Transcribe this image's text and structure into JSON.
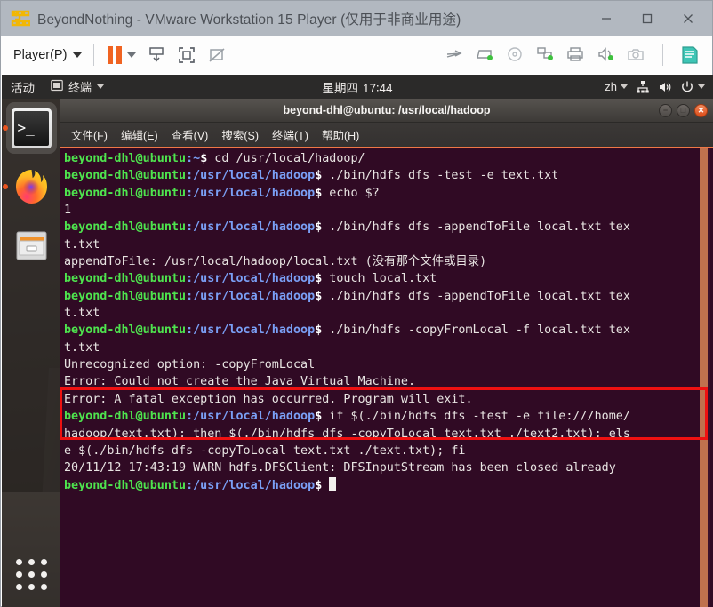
{
  "vmware": {
    "title": "BeyondNothing - VMware Workstation 15 Player (仅用于非商业用途)",
    "logo_icon": "vmware-logo-icon",
    "window_controls": [
      {
        "name": "minimize",
        "glyph": "—"
      },
      {
        "name": "maximize",
        "glyph": "▢"
      },
      {
        "name": "close",
        "glyph": "✕"
      }
    ],
    "toolbar": {
      "player_menu_label": "Player(P)",
      "left_icons": [
        "pause-icon",
        "pause-dropdown-caret-icon",
        "send-ctrl-alt-del-icon",
        "fullscreen-icon",
        "unity-mode-icon"
      ],
      "right_icons": [
        "network-adapter-icon",
        "removable-device-icon",
        "cd-dvd-icon",
        "network-icon",
        "printer-icon",
        "sound-icon",
        "camera-icon",
        "sidebar-icon"
      ]
    }
  },
  "ubuntu": {
    "topbar": {
      "activities_label": "活动",
      "app_menu_icon": "terminal-window-icon",
      "app_menu_label": "终端",
      "clock_day": "星期四",
      "clock_time": "17∶44",
      "tray": {
        "input_method_label": "zh",
        "network_icon": "network-wired-icon",
        "volume_icon": "volume-icon",
        "power_icon": "power-icon"
      }
    },
    "dock": {
      "items": [
        {
          "name": "terminal",
          "icon": "terminal-icon",
          "running": true,
          "focused": true,
          "glyph": ">_"
        },
        {
          "name": "firefox",
          "icon": "firefox-icon",
          "running": true,
          "focused": false
        },
        {
          "name": "files",
          "icon": "files-icon",
          "running": false,
          "focused": false
        }
      ],
      "show_apps_label": "show-applications"
    }
  },
  "terminal": {
    "title": "beyond-dhl@ubuntu: /usr/local/hadoop",
    "window_buttons": [
      {
        "name": "minimize",
        "glyph": "−"
      },
      {
        "name": "maximize",
        "glyph": "□"
      },
      {
        "name": "close",
        "glyph": "✕"
      }
    ],
    "menus": [
      "文件(F)",
      "编辑(E)",
      "查看(V)",
      "搜索(S)",
      "终端(T)",
      "帮助(H)"
    ],
    "prompt_user": "beyond-dhl@ubuntu",
    "colors": {
      "background": "#300a24",
      "user": "#4ee44e",
      "path": "#7a9ff5",
      "text": "#e8e4e2",
      "scrollbar": "#c0714e",
      "annotation": "#ee1111"
    },
    "lines": [
      {
        "type": "prompt",
        "cwd": ":~",
        "cmd": " cd /usr/local/hadoop/"
      },
      {
        "type": "prompt",
        "cwd": ":/usr/local/hadoop",
        "cmd": " ./bin/hdfs dfs -test -e text.txt"
      },
      {
        "type": "prompt",
        "cwd": ":/usr/local/hadoop",
        "cmd": " echo $?"
      },
      {
        "type": "out",
        "text": "1"
      },
      {
        "type": "prompt",
        "cwd": ":/usr/local/hadoop",
        "cmd": " ./bin/hdfs dfs -appendToFile local.txt tex"
      },
      {
        "type": "out",
        "text": "t.txt"
      },
      {
        "type": "out",
        "text": "appendToFile: /usr/local/hadoop/local.txt (没有那个文件或目录)"
      },
      {
        "type": "prompt",
        "cwd": ":/usr/local/hadoop",
        "cmd": " touch local.txt"
      },
      {
        "type": "prompt",
        "cwd": ":/usr/local/hadoop",
        "cmd": " ./bin/hdfs dfs -appendToFile local.txt tex"
      },
      {
        "type": "out",
        "text": "t.txt"
      },
      {
        "type": "prompt",
        "cwd": ":/usr/local/hadoop",
        "cmd": " ./bin/hdfs -copyFromLocal -f local.txt tex"
      },
      {
        "type": "out",
        "text": "t.txt"
      },
      {
        "type": "out",
        "text": "Unrecognized option: -copyFromLocal"
      },
      {
        "type": "out",
        "text": "Error: Could not create the Java Virtual Machine."
      },
      {
        "type": "out",
        "text": "Error: A fatal exception has occurred. Program will exit."
      },
      {
        "type": "prompt",
        "cwd": ":/usr/local/hadoop",
        "cmd": " if $(./bin/hdfs dfs -test -e file:///home/"
      },
      {
        "type": "out",
        "text": "hadoop/text.txt); then $(./bin/hdfs dfs -copyToLocal text.txt ./text2.txt); els"
      },
      {
        "type": "out",
        "text": "e $(./bin/hdfs dfs -copyToLocal text.txt ./text.txt); fi"
      },
      {
        "type": "out",
        "text": "20/11/12 17:43:19 WARN hdfs.DFSClient: DFSInputStream has been closed already"
      },
      {
        "type": "prompt",
        "cwd": ":/usr/local/hadoop",
        "cmd": " ",
        "cursor": true
      }
    ]
  }
}
